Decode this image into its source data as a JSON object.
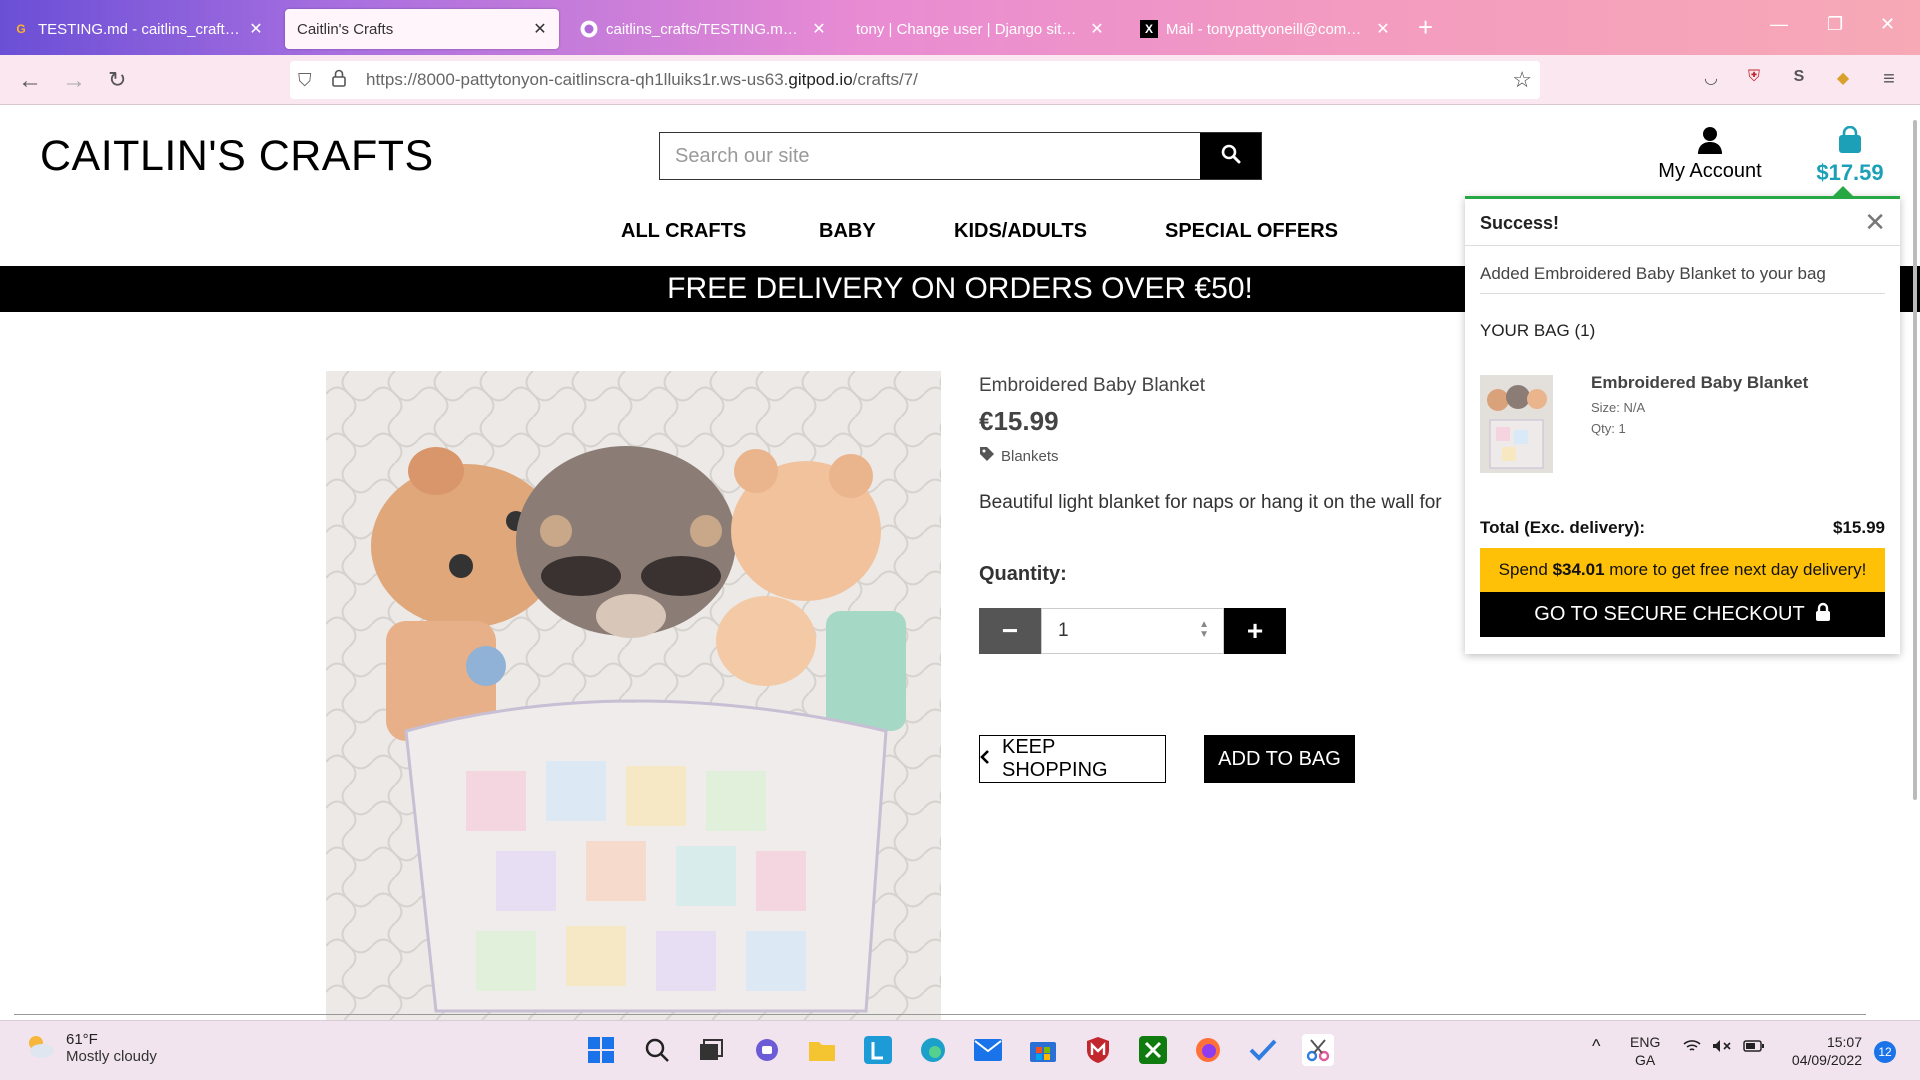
{
  "browser": {
    "tabs": [
      {
        "title": "TESTING.md - caitlins_crafts - G",
        "icon": "gitpod-icon"
      },
      {
        "title": "Caitlin's Crafts",
        "icon": "none"
      },
      {
        "title": "caitlins_crafts/TESTING.md at m",
        "icon": "github-icon"
      },
      {
        "title": "tony | Change user | Django site adr",
        "icon": "none"
      },
      {
        "title": "Mail - tonypattyoneill@comcas",
        "icon": "x-mail-icon"
      }
    ],
    "url_prefix": "https://8000-pattytonyon-caitlinscra-qh1lluiks1r.ws-us63.",
    "url_domain": "gitpod.io",
    "url_path": "/crafts/7/"
  },
  "site": {
    "logo": "CAITLIN'S CRAFTS",
    "search_placeholder": "Search our site",
    "account_label": "My Account",
    "bag_total": "$17.59",
    "nav": [
      "ALL CRAFTS",
      "BABY",
      "KIDS/ADULTS",
      "SPECIAL OFFERS"
    ],
    "banner": "FREE DELIVERY ON ORDERS OVER €50!"
  },
  "product": {
    "name": "Embroidered Baby Blanket",
    "price": "€15.99",
    "category": "Blankets",
    "description": "Beautiful light blanket for naps or hang it on the wall for",
    "quantity_label": "Quantity:",
    "quantity": "1",
    "keep_shopping": "KEEP SHOPPING",
    "add_to_bag": "ADD TO BAG"
  },
  "toast": {
    "title": "Success!",
    "message": "Added Embroidered Baby Blanket to your bag",
    "bag_header": "YOUR BAG (1)",
    "item_name": "Embroidered Baby Blanket",
    "item_size": "Size: N/A",
    "item_qty": "Qty: 1",
    "total_label": "Total (Exc. delivery):",
    "total_value": "$15.99",
    "spend_pre": "Spend ",
    "spend_amount": "$34.01",
    "spend_post": " more to get free next day delivery!",
    "checkout": "GO TO SECURE CHECKOUT"
  },
  "taskbar": {
    "temp": "61°F",
    "condition": "Mostly cloudy",
    "lang1": "ENG",
    "lang2": "GA",
    "time": "15:07",
    "date": "04/09/2022",
    "notifications": "12"
  },
  "colors": {
    "accent_teal": "#1ca0b7",
    "success_green": "#28a745",
    "warning_yellow": "#ffc107"
  }
}
